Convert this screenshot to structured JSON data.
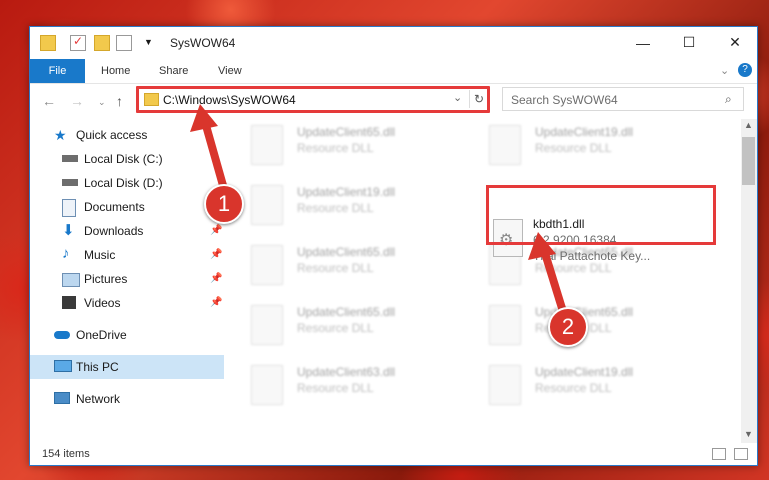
{
  "window": {
    "title": "SysWOW64"
  },
  "controls": {
    "minimize": "—",
    "maximize": "☐",
    "close": "✕"
  },
  "ribbon": {
    "file": "File",
    "tabs": [
      "Home",
      "Share",
      "View"
    ]
  },
  "address": {
    "path": "C:\\Windows\\SysWOW64"
  },
  "search": {
    "placeholder": "Search SysWOW64"
  },
  "sidebar": {
    "items": [
      {
        "label": "Quick access",
        "icon": "star-icon"
      },
      {
        "label": "Local Disk (C:)",
        "icon": "drive-icon"
      },
      {
        "label": "Local Disk (D:)",
        "icon": "drive-icon"
      },
      {
        "label": "Documents",
        "icon": "documents-icon"
      },
      {
        "label": "Downloads",
        "icon": "download-icon"
      },
      {
        "label": "Music",
        "icon": "music-icon"
      },
      {
        "label": "Pictures",
        "icon": "pictures-icon"
      },
      {
        "label": "Videos",
        "icon": "videos-icon"
      },
      {
        "label": "OneDrive",
        "icon": "cloud-icon"
      },
      {
        "label": "This PC",
        "icon": "computer-icon"
      },
      {
        "label": "Network",
        "icon": "network-icon"
      }
    ]
  },
  "files": [
    {
      "name": "UpdateClient65.dll",
      "type": "Resource DLL"
    },
    {
      "name": "UpdateClient19.dll",
      "type": "Resource DLL"
    },
    {
      "name": "UpdateClient19.dll",
      "type": "Resource DLL"
    },
    {
      "name": "UpdateClient65.dll",
      "type": "Resource DLL"
    },
    {
      "name": "UpdateClient65.dll",
      "type": "Resource DLL"
    },
    {
      "name": "UpdateClient65.dll",
      "type": "Resource DLL"
    },
    {
      "name": "UpdateClient65.dll",
      "type": "Resource DLL"
    },
    {
      "name": "UpdateClient63.dll",
      "type": "Resource DLL"
    },
    {
      "name": "UpdateClient19.dll",
      "type": "Resource DLL"
    }
  ],
  "featured": {
    "name": "kbdth1.dll",
    "version": "6.2.9200.16384",
    "description": "Thai Pattachote Key..."
  },
  "status": {
    "count": "154 items"
  },
  "callouts": [
    "1",
    "2"
  ],
  "colors": {
    "accent": "#1979ca",
    "highlight": "#e53a3a",
    "callout": "#d9352c"
  }
}
